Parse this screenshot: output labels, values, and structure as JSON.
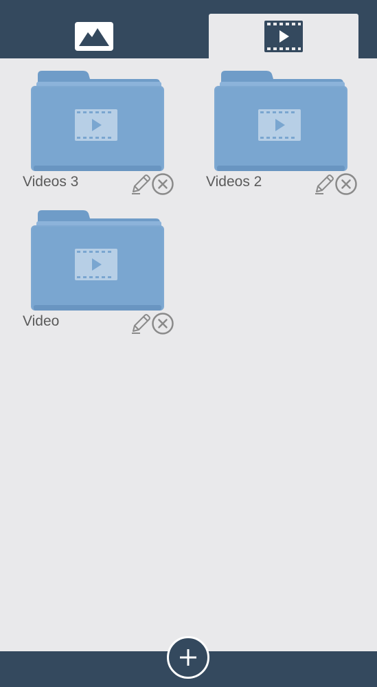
{
  "tabs": [
    {
      "id": "images",
      "icon": "image-icon",
      "active": false
    },
    {
      "id": "videos",
      "icon": "video-icon",
      "active": true
    }
  ],
  "folders": [
    {
      "name": "Videos 3",
      "icon": "video-folder-icon"
    },
    {
      "name": "Videos 2",
      "icon": "video-folder-icon"
    },
    {
      "name": "Video",
      "icon": "video-folder-icon"
    }
  ],
  "actions": {
    "edit_icon": "pencil-icon",
    "delete_icon": "close-circle-icon",
    "add_icon": "plus-icon"
  },
  "colors": {
    "bar": "#34495e",
    "background": "#e9e9eb",
    "folder": "#7fa9d2",
    "text": "#5a5a5a"
  }
}
